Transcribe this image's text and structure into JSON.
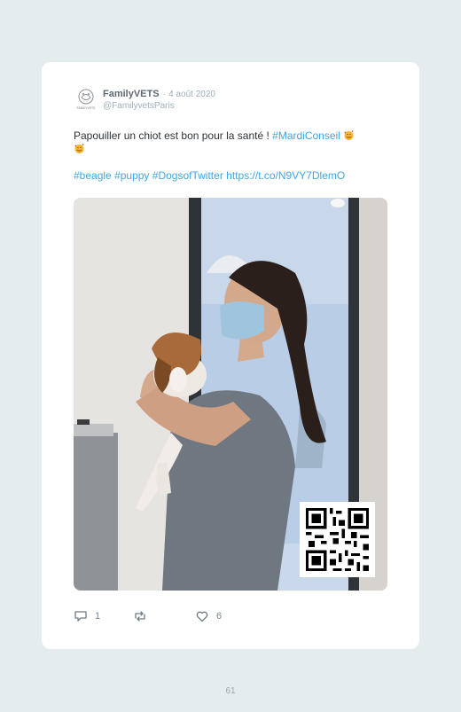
{
  "tweet": {
    "author_name": "FamilyVETS",
    "date": "· 4 août 2020",
    "handle": "@FamilyvetsParis",
    "avatar_caption": "FAMILYVETS",
    "text_main": "Papouiller un chiot est bon pour la santé ! ",
    "text_hashtag": "#MardiConseil",
    "emoji_icon": "smiling-face-with-hearts-icon",
    "hashtags": [
      "#beagle",
      "#puppy",
      "#DogsofTwitter"
    ],
    "link": "https://t.co/N9VY7DlemO",
    "media_description_icon": "photo-vet-holding-beagle-puppy",
    "qr_icon": "qr-code-icon",
    "replies": "1",
    "retweets": "",
    "likes": "6"
  },
  "colors": {
    "background": "#e5eced",
    "card": "#ffffff",
    "accent": "#3fa6e0",
    "text": "#2b3338",
    "muted": "#9fb0b8"
  },
  "page": {
    "number": "61"
  }
}
